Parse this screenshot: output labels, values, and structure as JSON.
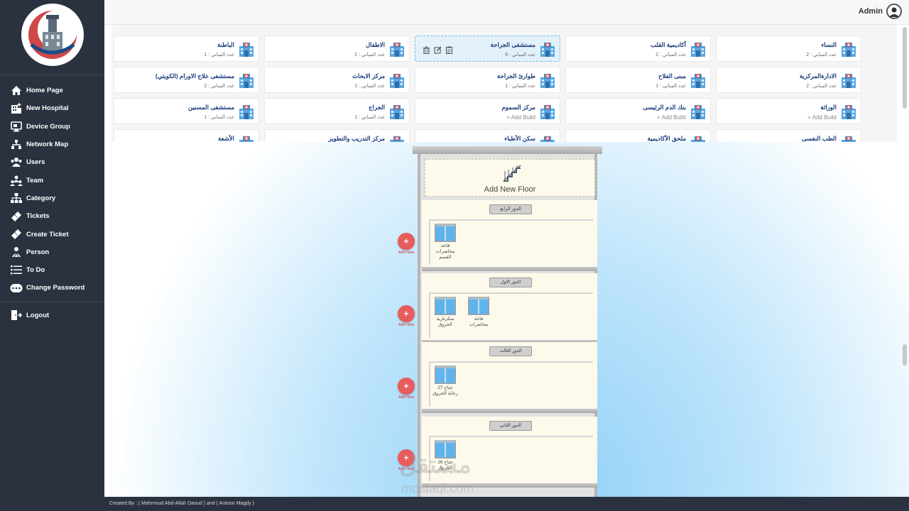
{
  "user": {
    "name": "Admin"
  },
  "nav": [
    {
      "label": "Home Page",
      "icon": "home-icon"
    },
    {
      "label": "New Hospital",
      "icon": "hospital-building-icon"
    },
    {
      "label": "Device Group",
      "icon": "monitor-icon"
    },
    {
      "label": "Network Map",
      "icon": "network-icon"
    },
    {
      "label": "Users",
      "icon": "users-icon"
    },
    {
      "label": "Team",
      "icon": "team-icon"
    },
    {
      "label": "Category",
      "icon": "sitemap-icon"
    },
    {
      "label": "Tickets",
      "icon": "ticket-icon"
    },
    {
      "label": "Create Ticket",
      "icon": "ticket-add-icon"
    },
    {
      "label": "Person",
      "icon": "person-icon"
    },
    {
      "label": "To Do",
      "icon": "list-icon"
    },
    {
      "label": "Change Password",
      "icon": "password-icon"
    }
  ],
  "logout": {
    "label": "Logout",
    "icon": "logout-icon"
  },
  "hospitals": [
    {
      "name": "النساء",
      "count": "عدد المباني : 2"
    },
    {
      "name": "أكاديمية القلب",
      "count": "عدد المباني : 2"
    },
    {
      "name": "مستشفى الجراحة",
      "count": "عدد المباني : 6",
      "selected": true
    },
    {
      "name": "الاطفال",
      "count": "عدد المباني : 2"
    },
    {
      "name": "الباطنة",
      "count": "عدد المباني : 1"
    },
    {
      "name": "الادارةالمركزية",
      "count": "عدد المباني : 2"
    },
    {
      "name": "مبنى الفلاح",
      "count": "عدد المباني : 1"
    },
    {
      "name": "طوارئ الجراحة",
      "count": "عدد المباني : 1"
    },
    {
      "name": "مركز الابحاث",
      "count": "عدد المباني : 1"
    },
    {
      "name": "مستشفى علاج الاورام (الكويتي)",
      "count": "عدد المباني : 2"
    },
    {
      "name": "الوراثة",
      "add": "+ Add Build"
    },
    {
      "name": "بنك الدم الرئيسى",
      "add": "+ Add Build"
    },
    {
      "name": "مركز السموم",
      "add": "+ Add Build"
    },
    {
      "name": "الجراج",
      "count": "عدد المباني : 1"
    },
    {
      "name": "مستشفى المسنين",
      "count": "عدد المباني : 1"
    },
    {
      "name": "الطب النفسى"
    },
    {
      "name": "ملحق الأكاديمية"
    },
    {
      "name": "سكن الأطباء"
    },
    {
      "name": "مركز التدريب والتطوير"
    },
    {
      "name": "الأشعة"
    }
  ],
  "building": {
    "add_floor_label": "Add New Floor",
    "add_new_label": "Add New",
    "add_new_symbol": "+",
    "floors": [
      {
        "label": "الدور الرابع",
        "rooms": [
          "قاعة محاضرات القسم"
        ]
      },
      {
        "label": "الدور الاول",
        "rooms": [
          "سكرتارية الحروق",
          "قاعة محاضرات"
        ]
      },
      {
        "label": "الدور الثالث",
        "rooms": [
          "جناح 27 رعاية الحروق"
        ]
      },
      {
        "label": "الدور الثاني",
        "rooms": [
          "جناح 26 الحروق"
        ]
      }
    ]
  },
  "watermark": {
    "main": "مستقل",
    "sub": "mostaql.com"
  },
  "footer": {
    "text": "Created By : ( Mahmoud Abd-Allah Daoud ) and ( Antoon Magdy )"
  }
}
